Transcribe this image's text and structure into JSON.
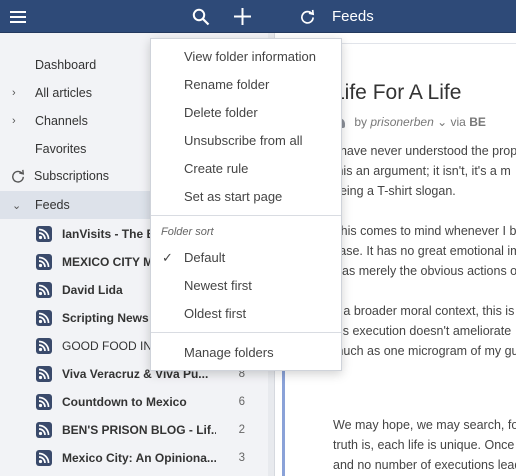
{
  "topbar": {
    "title": "Feeds",
    "menu_icon": "hamburger-icon",
    "search_icon": "search-icon",
    "add_icon": "plus-icon",
    "refresh_icon": "refresh-icon"
  },
  "sidebar": {
    "dashboard": "Dashboard",
    "all_articles": "All articles",
    "channels": "Channels",
    "favorites": "Favorites",
    "subscriptions": "Subscriptions",
    "feeds": "Feeds",
    "feed_items": [
      {
        "label": "IanVisits - The B",
        "count": ""
      },
      {
        "label": "MEXICO CITY M",
        "count": ""
      },
      {
        "label": "David Lida",
        "count": ""
      },
      {
        "label": "Scripting News",
        "count": ""
      },
      {
        "label": "GOOD FOOD IN",
        "count": ""
      },
      {
        "label": "Viva Veracruz & Viva Pu...",
        "count": "8"
      },
      {
        "label": "Countdown to Mexico",
        "count": "6"
      },
      {
        "label": "BEN'S PRISON BLOG - Lif...",
        "count": "2"
      },
      {
        "label": "Mexico City: An Opiniona...",
        "count": "3"
      }
    ]
  },
  "article": {
    "title": "Life For A Life",
    "by": "by",
    "author": "prisonerben",
    "via": "via",
    "source": "BE",
    "lines": [
      "I have never understood the prop",
      "this an argument; it isn't, it's a m",
      "being a T-shirt slogan.",
      "",
      "This comes to mind whenever I b",
      "case. It has no great emotional im",
      "was merely the obvious actions o",
      "",
      "n a broader moral context, this is",
      "his execution doesn't ameliorate",
      "much as one microgram of my gu",
      "",
      "",
      "We may hope, we may search, fo",
      "truth is, each life is unique. Once",
      "and no number of executions lead"
    ]
  },
  "folder_menu": {
    "items": [
      "View folder information",
      "Rename folder",
      "Delete folder",
      "Unsubscribe from all",
      "Create rule",
      "Set as start page"
    ],
    "sort_header": "Folder sort",
    "sort_options": [
      "Default",
      "Newest first",
      "Oldest first"
    ],
    "selected_sort": "Default",
    "manage": "Manage folders"
  },
  "colors": {
    "topbar": "#2e4a78",
    "sidebar": "#f2f3f6",
    "selected": "#dde2ea",
    "accent_bar": "#8aa2d8"
  }
}
